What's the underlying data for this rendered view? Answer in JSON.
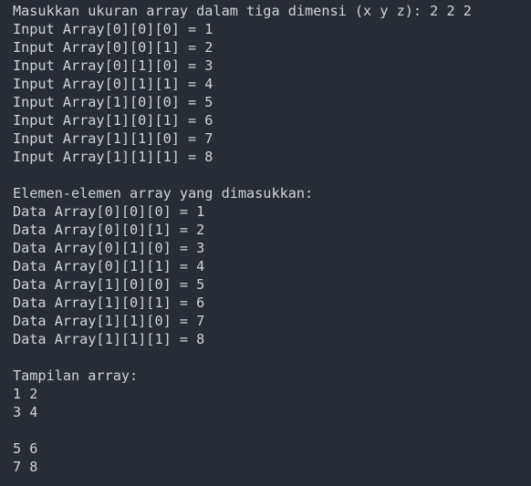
{
  "terminal": {
    "lines": [
      "Masukkan ukuran array dalam tiga dimensi (x y z): 2 2 2",
      "Input Array[0][0][0] = 1",
      "Input Array[0][0][1] = 2",
      "Input Array[0][1][0] = 3",
      "Input Array[0][1][1] = 4",
      "Input Array[1][0][0] = 5",
      "Input Array[1][0][1] = 6",
      "Input Array[1][1][0] = 7",
      "Input Array[1][1][1] = 8",
      "",
      "Elemen-elemen array yang dimasukkan:",
      "Data Array[0][0][0] = 1",
      "Data Array[0][0][1] = 2",
      "Data Array[0][1][0] = 3",
      "Data Array[0][1][1] = 4",
      "Data Array[1][0][0] = 5",
      "Data Array[1][0][1] = 6",
      "Data Array[1][1][0] = 7",
      "Data Array[1][1][1] = 8",
      "",
      "Tampilan array:",
      "1 2",
      "3 4",
      "",
      "5 6",
      "7 8"
    ]
  },
  "colors": {
    "background": "#282c34",
    "text": "#cfd3da"
  }
}
